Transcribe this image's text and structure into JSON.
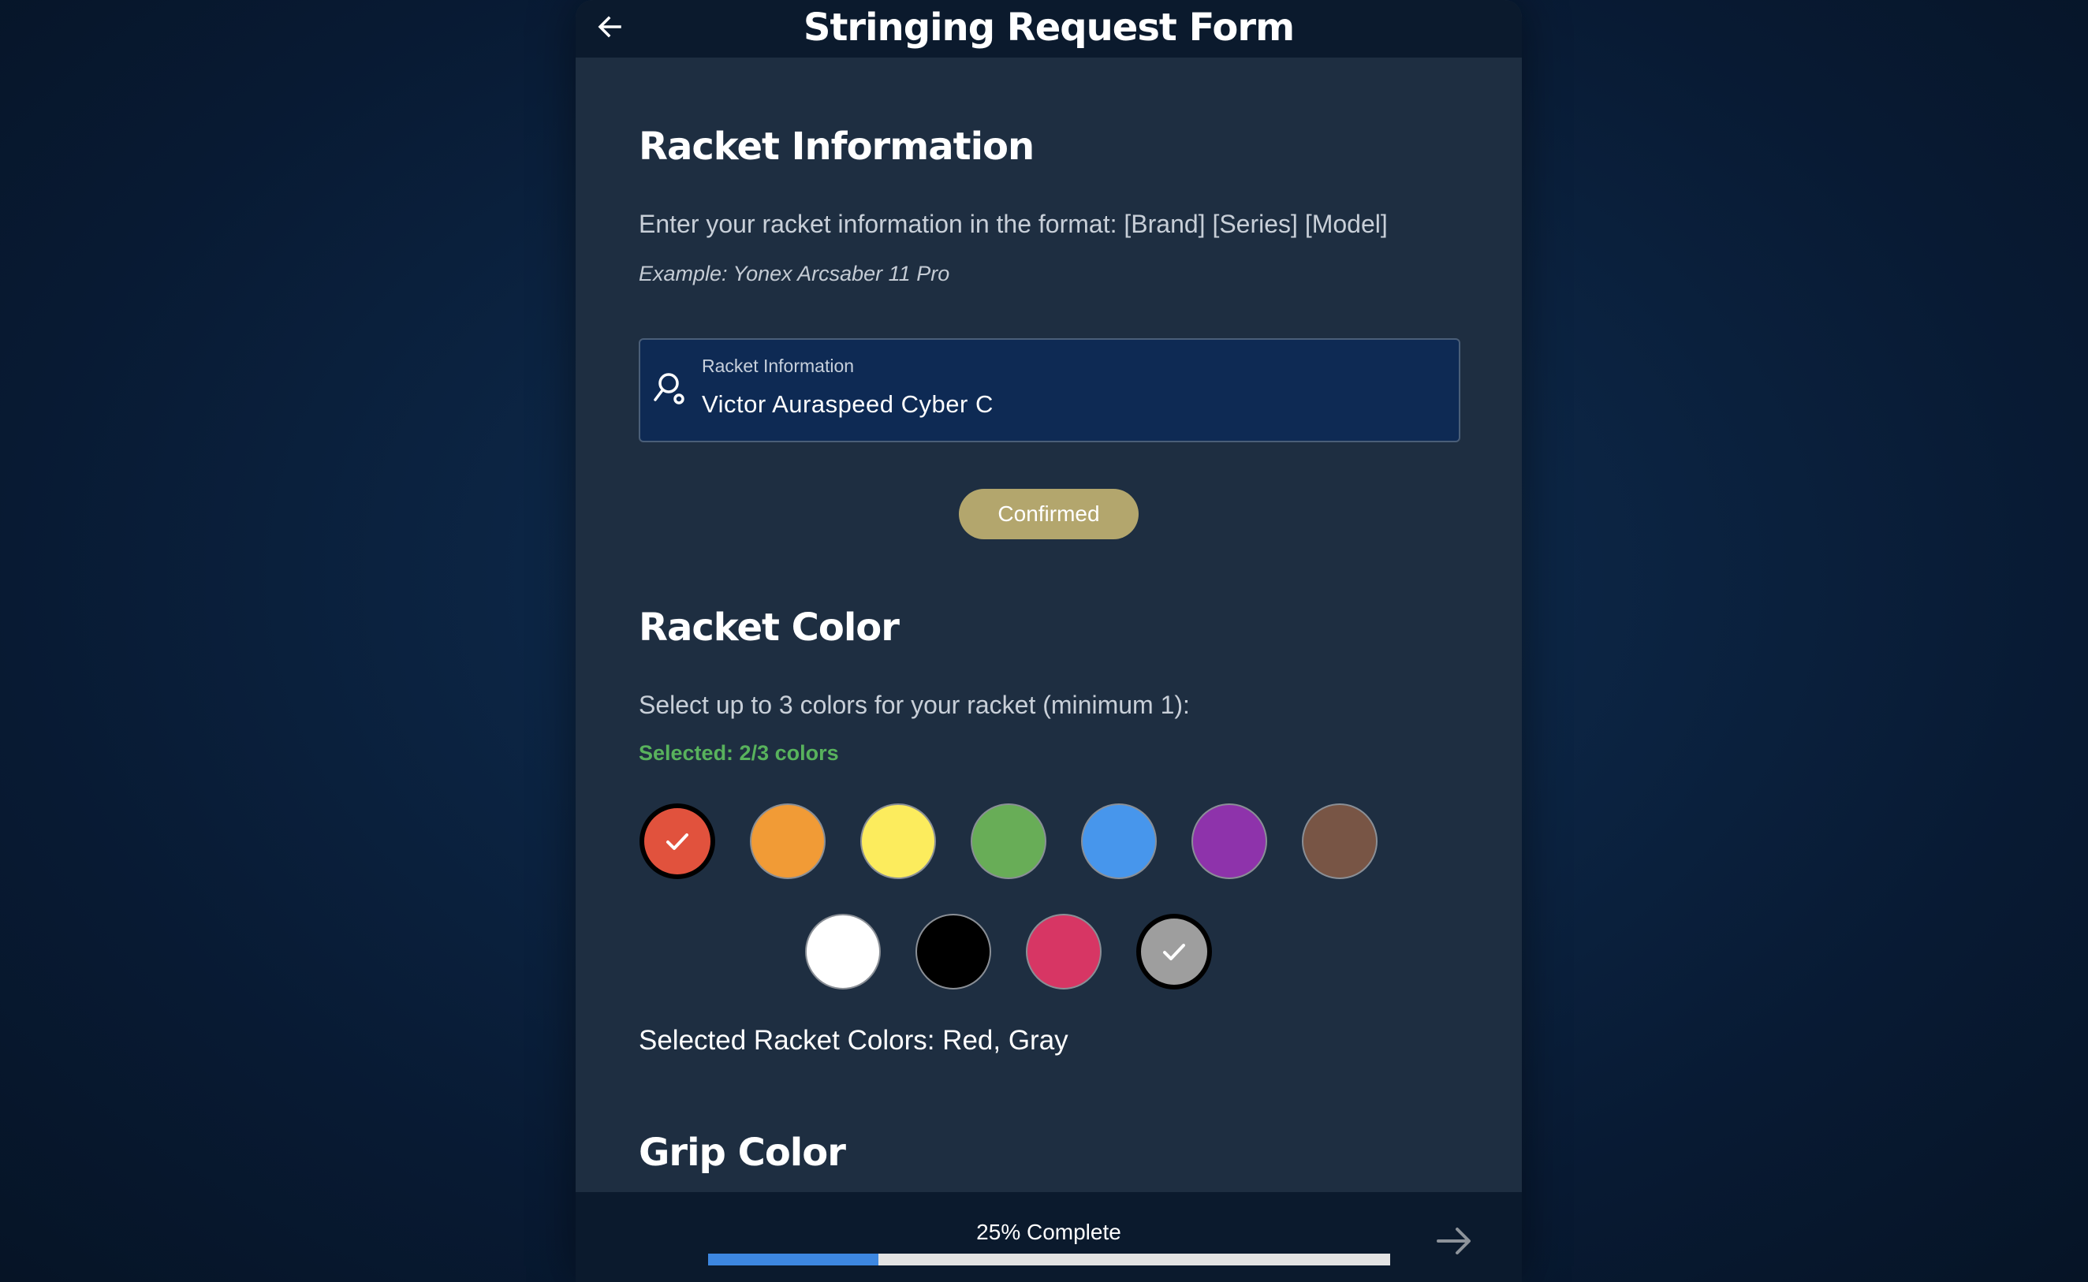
{
  "header": {
    "title": "Stringing Request Form"
  },
  "racket_info": {
    "title": "Racket Information",
    "instruction": "Enter your racket information in the format: [Brand] [Series] [Model]",
    "example": "Example: Yonex Arcsaber 11 Pro",
    "field_label": "Racket Information",
    "field_value": "Victor Auraspeed Cyber C",
    "confirm_label": "Confirmed",
    "confirm_color": "#b3a66d"
  },
  "racket_color": {
    "title": "Racket Color",
    "instruction": "Select up to 3 colors for your racket (minimum 1):",
    "selected_count": "Selected: 2/3 colors",
    "swatches": [
      {
        "name": "Red",
        "hex": "#e1523d",
        "selected": true
      },
      {
        "name": "Orange",
        "hex": "#f19b36",
        "selected": false
      },
      {
        "name": "Yellow",
        "hex": "#fcec5d",
        "selected": false
      },
      {
        "name": "Green",
        "hex": "#68ad57",
        "selected": false
      },
      {
        "name": "Blue",
        "hex": "#4796ec",
        "selected": false
      },
      {
        "name": "Purple",
        "hex": "#8e33ab",
        "selected": false
      },
      {
        "name": "Brown",
        "hex": "#785545",
        "selected": false
      },
      {
        "name": "White",
        "hex": "#ffffff",
        "selected": false
      },
      {
        "name": "Black",
        "hex": "#000000",
        "selected": false
      },
      {
        "name": "Pink",
        "hex": "#d73664",
        "selected": false
      },
      {
        "name": "Gray",
        "hex": "#9e9e9e",
        "selected": true
      }
    ],
    "selected_summary": "Selected Racket Colors: Red, Gray"
  },
  "grip_color": {
    "title": "Grip Color"
  },
  "footer": {
    "progress_label": "25% Complete",
    "progress_fraction": 0.25,
    "progress_color": "#3d87e0"
  }
}
